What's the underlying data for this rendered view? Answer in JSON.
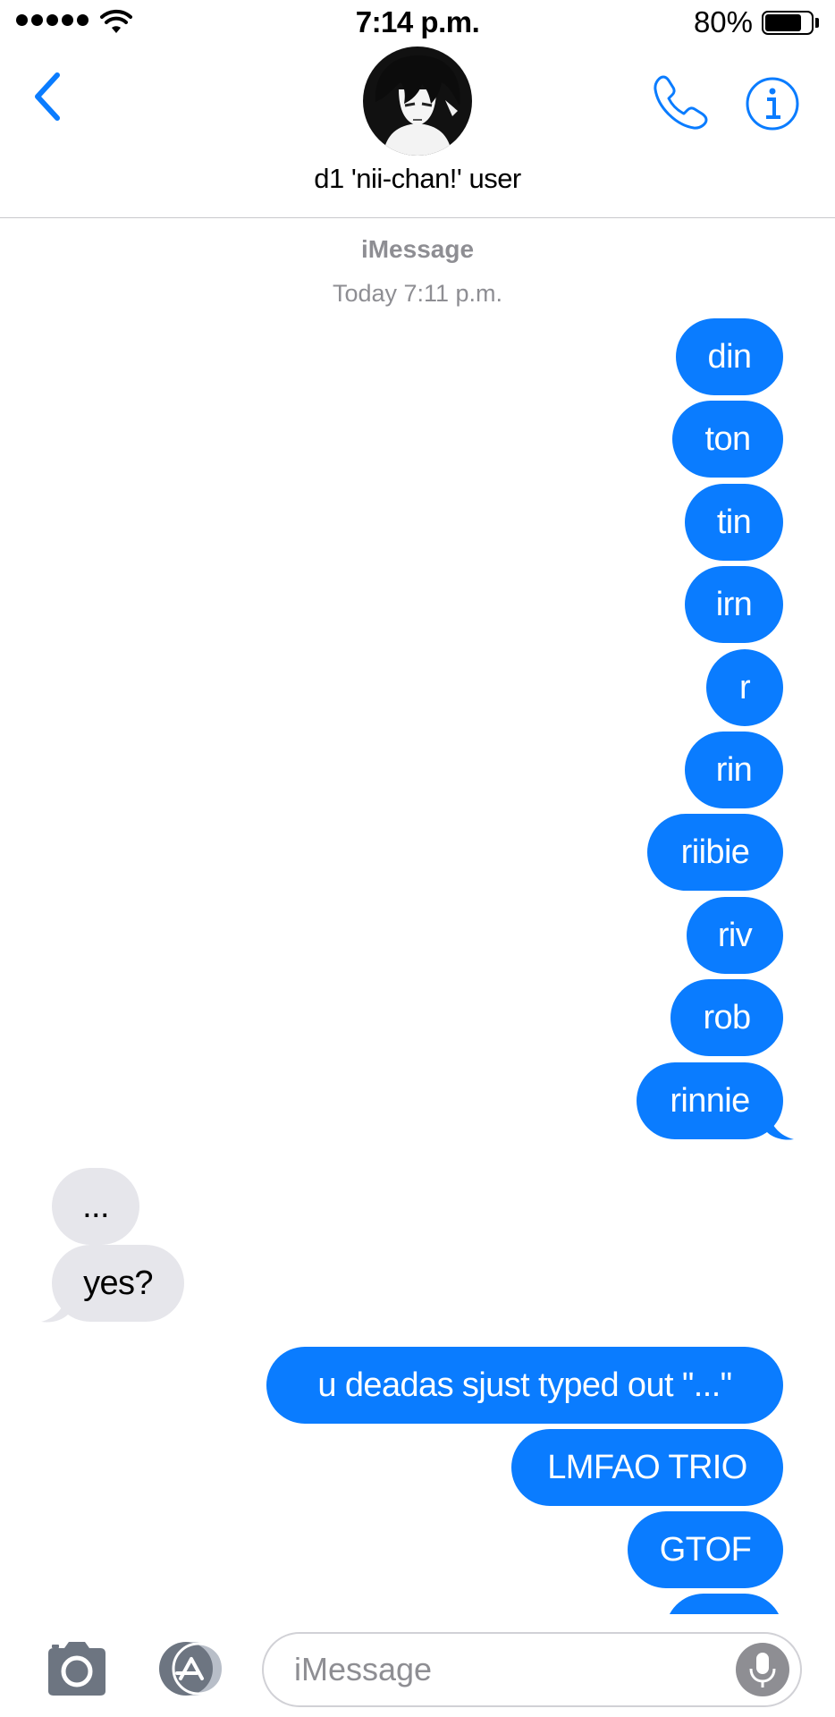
{
  "status_bar": {
    "time": "7:14 p.m.",
    "battery_percent": "80%",
    "battery_level": 0.8
  },
  "header": {
    "contact_name": "d1 'nii-chan!' user",
    "back_icon": "chevron-left-icon",
    "call_icon": "phone-icon",
    "info_icon": "info-icon"
  },
  "thread": {
    "service": "iMessage",
    "timestamp": "Today 7:11 p.m."
  },
  "messages": [
    {
      "from": "me",
      "text": "din"
    },
    {
      "from": "me",
      "text": "ton"
    },
    {
      "from": "me",
      "text": "tin"
    },
    {
      "from": "me",
      "text": "irn"
    },
    {
      "from": "me",
      "text": "r"
    },
    {
      "from": "me",
      "text": "rin"
    },
    {
      "from": "me",
      "text": "riibie"
    },
    {
      "from": "me",
      "text": "riv"
    },
    {
      "from": "me",
      "text": "rob"
    },
    {
      "from": "me",
      "text": "rinnie"
    },
    {
      "from": "them",
      "text": "..."
    },
    {
      "from": "them",
      "text": "yes?"
    },
    {
      "from": "me",
      "text": "u deadas sjust typed out \"...\""
    },
    {
      "from": "me",
      "text": "LMFAO TRIO"
    },
    {
      "from": "me",
      "text": "GTOF"
    }
  ],
  "composer": {
    "placeholder": "iMessage",
    "camera_icon": "camera-icon",
    "apps_icon": "app-store-icon",
    "mic_icon": "microphone-icon"
  },
  "colors": {
    "accent": "#0a7cff",
    "incoming_bubble": "#e6e6eb",
    "secondary_text": "#8e8e93"
  }
}
